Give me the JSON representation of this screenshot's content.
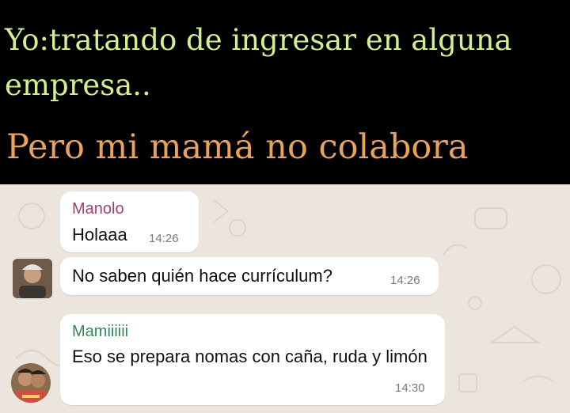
{
  "meme": {
    "caption": "Yo:tratando de ingresar en alguna empresa..",
    "headline": "Pero mi mamá no colabora"
  },
  "colors": {
    "caption": "#d4ef8e",
    "headline": "#e8a25c",
    "chat_background": "#ece5dd",
    "sender_manolo": "#a03f73",
    "sender_mamiiiiii": "#2f8a5a"
  },
  "chat": {
    "messages": [
      {
        "sender": "Manolo",
        "text": "Holaaa",
        "time": "14:26"
      },
      {
        "sender": "",
        "text": "No saben quién hace currículum?",
        "time": "14:26"
      },
      {
        "sender": "Mamiiiiii",
        "text": "Eso se prepara nomas con caña, ruda y limón",
        "time": "14:30"
      }
    ]
  }
}
